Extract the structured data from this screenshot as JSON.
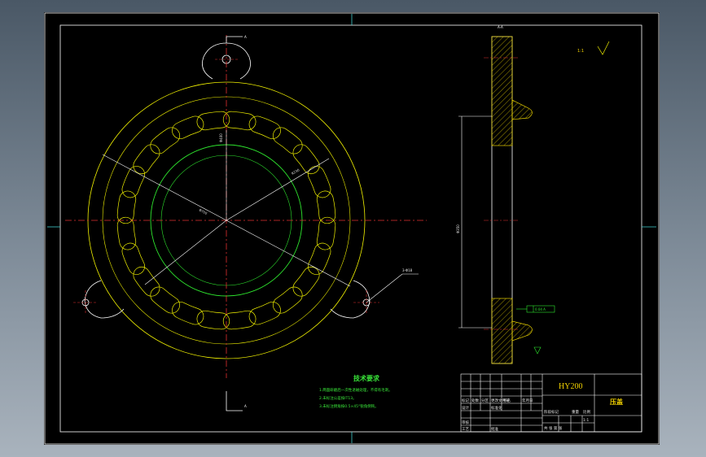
{
  "drawing": {
    "part_code": "HY200",
    "part_name": "压盖",
    "roughness_note": "1:1",
    "section_label": "A-A",
    "detail_mark": "A",
    "tolerance_box": "0.04  A",
    "datum_a": "A"
  },
  "dimensions": {
    "bolt_circle": "Φ700",
    "inner_circle": "Φ400",
    "radius_slot": "R230",
    "hole_callout": "3-Φ18",
    "vertical_height": "Φ350",
    "slot_depth": "R20"
  },
  "notes": {
    "title": "技术要求",
    "items": [
      "1.两面研磨后一次性退磁处理，不得有毛刺。",
      "2.未标注公差按IT13。",
      "3.未标注倒角按0.5×45°锐角倒钝。"
    ]
  },
  "title_block": {
    "labels": {
      "design": "设计",
      "check": "审核",
      "process": "工艺",
      "standard": "标准化",
      "approve": "批准",
      "mark": "标记",
      "count": "处数",
      "zone": "分区",
      "change_doc": "更改文件号",
      "signature": "签名",
      "date": "年月日",
      "stage_mark": "阶段标记",
      "weight": "重量",
      "scale": "比例",
      "sheet": "共  张  第  张",
      "scale_value": "1:1"
    }
  }
}
